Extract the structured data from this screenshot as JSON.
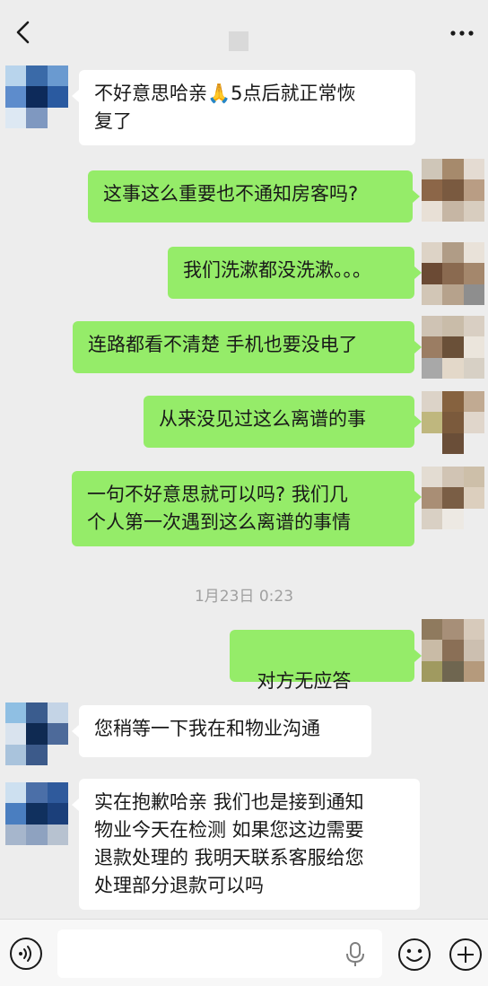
{
  "header": {
    "back_icon": "chevron-left-icon",
    "more_icon": "more-dots-icon"
  },
  "messages": [
    {
      "side": "in",
      "text": "不好意思哈亲🙏5点后就正常恢\n复了"
    },
    {
      "side": "out",
      "text": "这事这么重要也不通知房客吗?"
    },
    {
      "side": "out",
      "text": "我们洗漱都没洗漱。。。"
    },
    {
      "side": "out",
      "text": "连路都看不清楚 手机也要没电了"
    },
    {
      "side": "out",
      "text": "从来没见过这么离谱的事"
    },
    {
      "side": "out",
      "text": "一句不好意思就可以吗? 我们几\n个人第一次遇到这么离谱的事情"
    },
    {
      "side": "out",
      "text": "对方无应答",
      "icon": "hang-up-phone-icon"
    },
    {
      "side": "in",
      "text": "您稍等一下我在和物业沟通"
    },
    {
      "side": "in",
      "text": "实在抱歉哈亲 我们也是接到通知\n物业今天在检测 如果您这边需要\n退款处理的 我明天联系客服给您\n处理部分退款可以吗"
    }
  ],
  "timestamp": "1月23日 0:23",
  "input_bar": {
    "voice_icon": "voice-mode-icon",
    "input_value": "",
    "mic_icon": "microphone-icon",
    "emoji_icon": "emoji-icon",
    "plus_icon": "plus-icon"
  },
  "colors": {
    "background": "#ededed",
    "outgoing_bubble": "#95ec69",
    "incoming_bubble": "#ffffff"
  }
}
